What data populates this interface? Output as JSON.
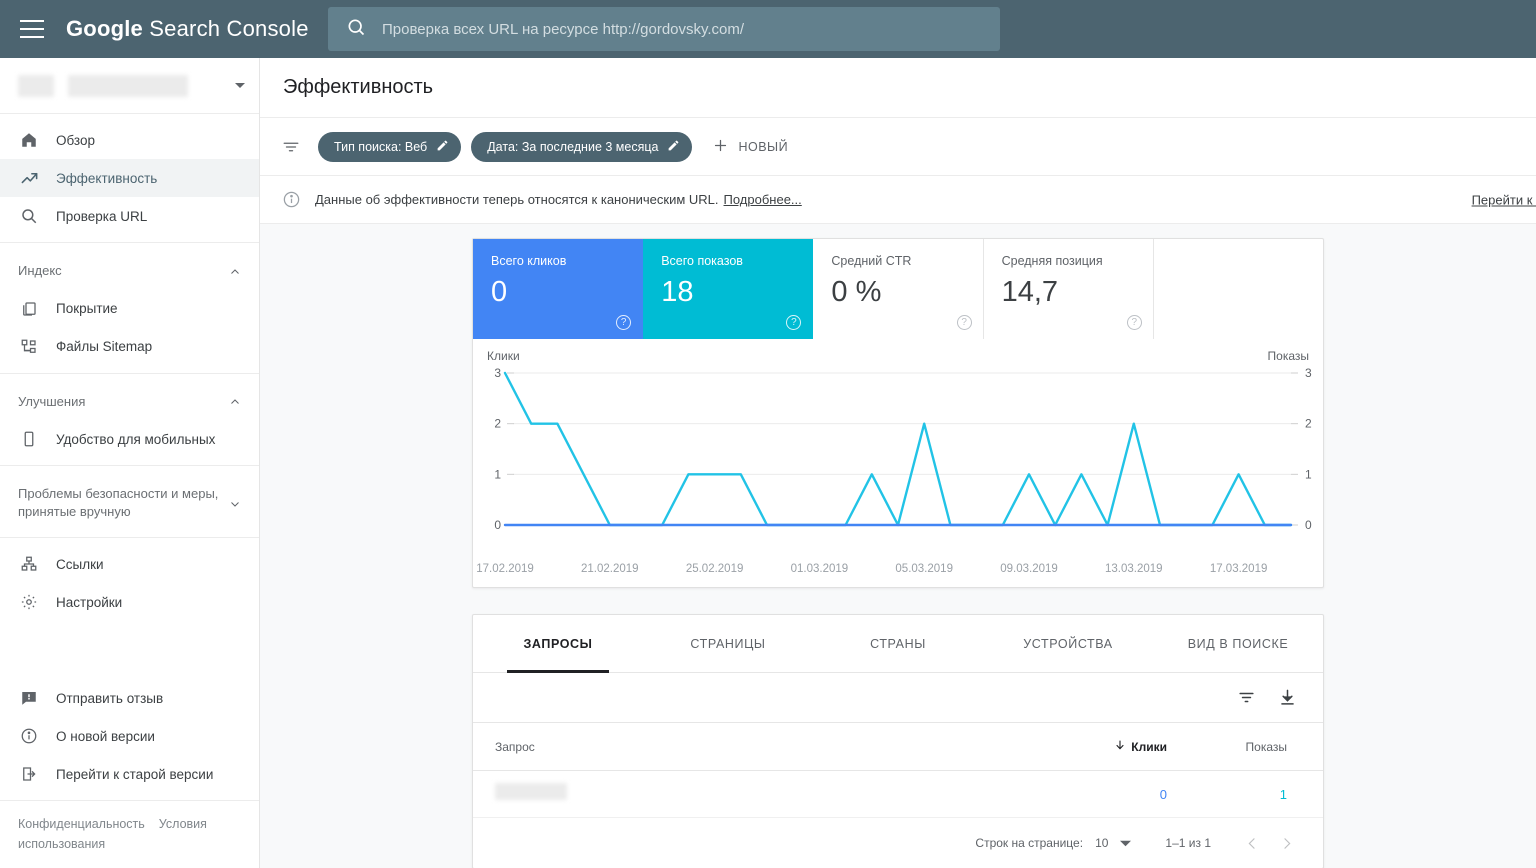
{
  "header": {
    "brand_bold": "Google",
    "brand_rest": "Search Console",
    "menu_icon": "hamburger-icon",
    "search_icon": "search-icon",
    "search_placeholder": "Проверка всех URL на ресурсе http://gordovsky.com/",
    "search_value": ""
  },
  "sidebar": {
    "property_label": "",
    "groups": [
      {
        "items": [
          {
            "label": "Обзор",
            "icon": "home-icon",
            "active": false
          },
          {
            "label": "Эффективность",
            "icon": "trending-up-icon",
            "active": true
          },
          {
            "label": "Проверка URL",
            "icon": "search-icon",
            "active": false
          }
        ]
      },
      {
        "section": "Индекс",
        "collapse_icon": "chevron-up-icon",
        "items": [
          {
            "label": "Покрытие",
            "icon": "pages-icon",
            "active": false
          },
          {
            "label": "Файлы Sitemap",
            "icon": "sitemap-icon",
            "active": false
          }
        ]
      },
      {
        "section": "Улучшения",
        "collapse_icon": "chevron-up-icon",
        "items": [
          {
            "label": "Удобство для мобильных",
            "icon": "mobile-icon",
            "active": false
          }
        ]
      },
      {
        "section": "Проблемы безопасности и меры, принятые вручную",
        "collapse_icon": "chevron-down-icon",
        "items": []
      },
      {
        "items": [
          {
            "label": "Ссылки",
            "icon": "links-icon",
            "active": false
          },
          {
            "label": "Настройки",
            "icon": "gear-icon",
            "active": false
          }
        ]
      }
    ],
    "bottom_items": [
      {
        "label": "Отправить отзыв",
        "icon": "feedback-icon"
      },
      {
        "label": "О новой версии",
        "icon": "info-icon"
      },
      {
        "label": "Перейти к старой версии",
        "icon": "exit-icon"
      }
    ],
    "footer": {
      "privacy": "Конфиденциальность",
      "terms": "Условия использования"
    }
  },
  "main": {
    "page_title": "Эффективность",
    "filters": {
      "filter_icon": "filter-icon",
      "chips": [
        {
          "label": "Тип поиска: Веб",
          "edit_icon": "pencil-icon"
        },
        {
          "label": "Дата: За последние 3 месяца",
          "edit_icon": "pencil-icon"
        }
      ],
      "new_label": "НОВЫЙ",
      "new_icon": "plus-icon"
    },
    "notice": {
      "icon": "info-icon",
      "text": "Данные об эффективности теперь относятся к каноническим URL.",
      "link": "Подробнее...",
      "old_version_link": "Перейти к старо"
    },
    "metrics": [
      {
        "label": "Всего кликов",
        "value": "0",
        "style": "blue",
        "help_icon": "help-icon"
      },
      {
        "label": "Всего показов",
        "value": "18",
        "style": "teal",
        "help_icon": "help-icon"
      },
      {
        "label": "Средний CTR",
        "value": "0 %",
        "style": "plain",
        "help_icon": "help-icon"
      },
      {
        "label": "Средняя позиция",
        "value": "14,7",
        "style": "plain",
        "help_icon": "help-icon"
      },
      {
        "label": "",
        "value": "",
        "style": "empty",
        "help_icon": ""
      }
    ],
    "table": {
      "tabs": [
        {
          "label": "ЗАПРОСЫ",
          "active": true
        },
        {
          "label": "СТРАНИЦЫ",
          "active": false
        },
        {
          "label": "СТРАНЫ",
          "active": false
        },
        {
          "label": "УСТРОЙСТВА",
          "active": false
        },
        {
          "label": "ВИД В ПОИСКЕ",
          "active": false
        }
      ],
      "tools": [
        {
          "icon": "filter-icon",
          "name": "table-filter-button"
        },
        {
          "icon": "download-icon",
          "name": "table-export-button"
        }
      ],
      "columns": {
        "query": "Запрос",
        "clicks": "Клики",
        "impressions": "Показы",
        "sort_icon": "arrow-down-icon",
        "sorted_by": "Клики"
      },
      "rows": [
        {
          "query": "",
          "clicks": "0",
          "impressions": "1"
        }
      ],
      "pagination": {
        "rows_label": "Строк на странице:",
        "rows_value": "10",
        "dropdown_icon": "caret-down-icon",
        "range": "1–1 из 1",
        "prev_icon": "chevron-left-icon",
        "next_icon": "chevron-right-icon"
      }
    }
  },
  "chart_data": {
    "type": "line",
    "title": "",
    "ylabel": "Клики",
    "y2label": "Показы",
    "xlabel": "",
    "ylim": [
      0,
      3
    ],
    "y2lim": [
      0,
      3
    ],
    "yticks": [
      "0",
      "1",
      "2",
      "3"
    ],
    "y2ticks": [
      "0",
      "1",
      "2",
      "3"
    ],
    "grid": true,
    "legend_position": "axis-labels",
    "x_tick_labels": [
      "17.02.2019",
      "21.02.2019",
      "25.02.2019",
      "01.03.2019",
      "05.03.2019",
      "09.03.2019",
      "13.03.2019",
      "17.03.2019"
    ],
    "x_tick_indices": [
      0,
      4,
      8,
      12,
      16,
      20,
      24,
      28
    ],
    "x_dates": [
      "17.02.2019",
      "18.02.2019",
      "19.02.2019",
      "20.02.2019",
      "21.02.2019",
      "22.02.2019",
      "23.02.2019",
      "24.02.2019",
      "25.02.2019",
      "26.02.2019",
      "27.02.2019",
      "28.02.2019",
      "01.03.2019",
      "02.03.2019",
      "03.03.2019",
      "04.03.2019",
      "05.03.2019",
      "06.03.2019",
      "07.03.2019",
      "08.03.2019",
      "09.03.2019",
      "10.03.2019",
      "11.03.2019",
      "12.03.2019",
      "13.03.2019",
      "14.03.2019",
      "15.03.2019",
      "16.03.2019",
      "17.03.2019",
      "18.03.2019",
      "19.03.2019"
    ],
    "series": [
      {
        "name": "Клики",
        "color": "#4285f4",
        "values": [
          0,
          0,
          0,
          0,
          0,
          0,
          0,
          0,
          0,
          0,
          0,
          0,
          0,
          0,
          0,
          0,
          0,
          0,
          0,
          0,
          0,
          0,
          0,
          0,
          0,
          0,
          0,
          0,
          0,
          0,
          0
        ]
      },
      {
        "name": "Показы",
        "color": "#22c3e6",
        "values": [
          3,
          2,
          2,
          1,
          0,
          0,
          0,
          1,
          1,
          1,
          0,
          0,
          0,
          0,
          1,
          0,
          2,
          0,
          0,
          0,
          1,
          0,
          1,
          0,
          2,
          0,
          0,
          0,
          1,
          0,
          0
        ]
      }
    ]
  }
}
